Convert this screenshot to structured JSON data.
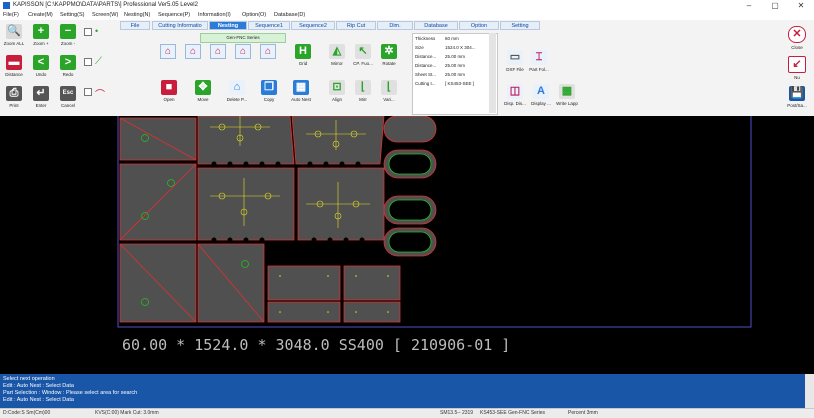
{
  "window": {
    "title": "KAPISSON [C:\\KAPPMO\\DATA\\PARTS\\] Professional Ver5.05 Level2",
    "minimize": "–",
    "maximize": "▢",
    "close": "✕"
  },
  "menu": [
    "File(F)",
    "Create(M)",
    "Setting(S)",
    "Screen(W)",
    "Nesting(N)",
    "Sequence(P)",
    "Information(I)",
    "Option(O)",
    "Database(D)"
  ],
  "toolbar": {
    "zoom_buttons": [
      {
        "label": "Zoom ALL",
        "icon": "zoom-all-icon",
        "glyph": "🔍"
      },
      {
        "label": "Zoom +",
        "icon": "zoom-in-icon",
        "glyph": "+"
      },
      {
        "label": "Zoom -",
        "icon": "zoom-out-icon",
        "glyph": "−"
      }
    ],
    "edit_buttons": [
      {
        "label": "Distance",
        "icon": "distance-icon",
        "glyph": "▬"
      },
      {
        "label": "Undo",
        "icon": "undo-icon",
        "glyph": "<"
      },
      {
        "label": "Redo",
        "icon": "redo-icon",
        "glyph": ">"
      }
    ],
    "misc_buttons": [
      {
        "label": "Print",
        "icon": "print-icon",
        "glyph": "⎙"
      },
      {
        "label": "Enter",
        "icon": "enter-icon",
        "glyph": "↵"
      },
      {
        "label": "Cancel",
        "icon": "cancel-icon",
        "glyph": "Esc"
      }
    ],
    "tabs": [
      "File",
      "Cutting Informatio",
      "Nesting",
      "Sequence1",
      "Sequence2",
      "Rip Cut",
      "Dim.",
      "Database",
      "Option",
      "Setting"
    ],
    "active_tab": "Nesting",
    "series_label": "Gen-FNC Series",
    "nesting_buttons": [
      "Open",
      "Move",
      "Delete P...",
      "Copy",
      "Auto Nest",
      "Align",
      "Mirr",
      "Vari..."
    ],
    "tool_buttons": [
      "Grid",
      "Mirror",
      "CP. Fuo...",
      "Rotate"
    ],
    "sheet_info": [
      {
        "k": "Thickness",
        "v": "60 mm"
      },
      {
        "k": "Size",
        "v": "1524.0 X 304..."
      },
      {
        "k": "Distance...",
        "v": "25.00 mm"
      },
      {
        "k": "Distance...",
        "v": "25.00 mm"
      },
      {
        "k": "Sheet St...",
        "v": "25.00 mm"
      },
      {
        "k": "Cutting t...",
        "v": "[ KS453-SEE ]"
      }
    ],
    "file_buttons": [
      "DXF File",
      "Part Fol..."
    ],
    "display_buttons": [
      "Disp. Dis...",
      "Display ...",
      "Write Lapp"
    ],
    "right_buttons": [
      {
        "label": "Close",
        "icon": "close-circle-icon",
        "glyph": "✕"
      },
      {
        "label": "Nu",
        "icon": "new-icon",
        "glyph": "↙"
      },
      {
        "label": "Post/Sa...",
        "icon": "save-icon",
        "glyph": "💾"
      }
    ]
  },
  "canvas": {
    "sheet_caption": "60.00 * 1524.0 * 3048.0 SS400 [ 210906-01 ]"
  },
  "messages": [
    "Select next operation",
    "Edit : Auto Nest : Select Data",
    "Part Selection : Window : Please select area for search",
    "Edit : Auto Nest : Select Data"
  ],
  "status": {
    "left": "D:Code:S Sm(Cm)00",
    "center_left": "KVS(C:00) Mark Cut: 3.0mm",
    "center": "SM13.5-- 2319",
    "series": "KS453-SEE Gen-FNC Series",
    "right": "Percent 3mm"
  },
  "colors": {
    "canvas_bg": "#000000",
    "part_fill": "#505050",
    "part_outline": "#e03030",
    "hole_outline": "#20c020",
    "marking": "#e6e020",
    "sheet_border": "#5050c8",
    "message_bg": "#1a56a8",
    "active_tab": "#2b7bd8"
  }
}
